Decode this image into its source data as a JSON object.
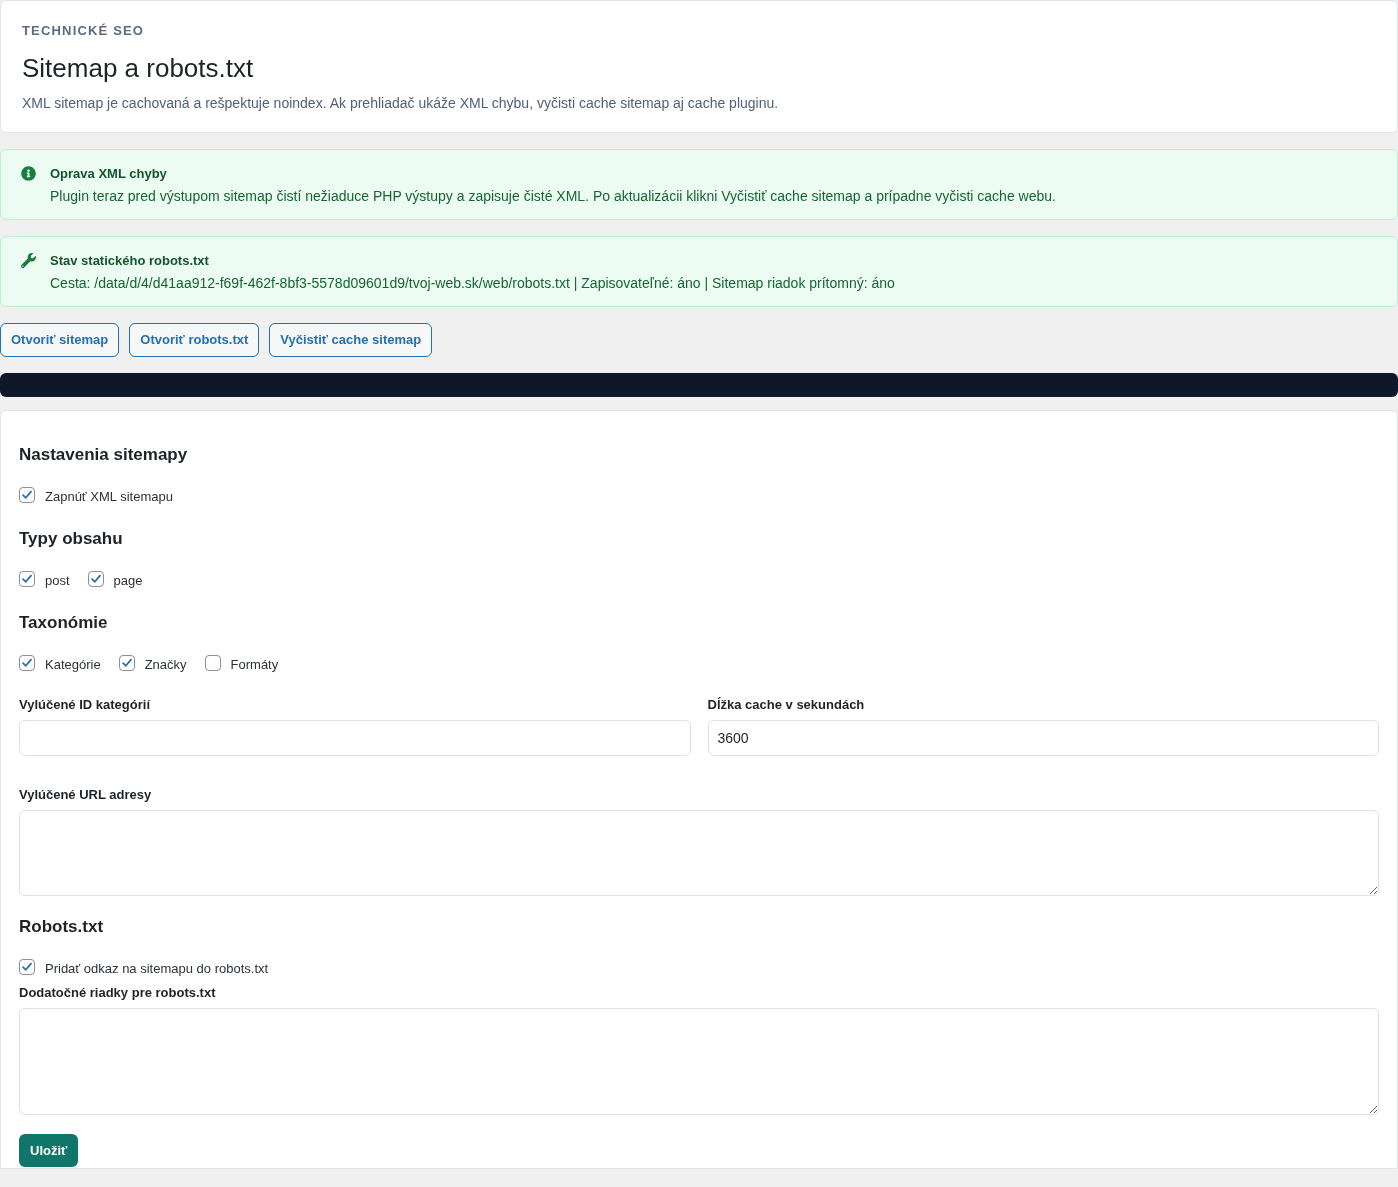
{
  "header": {
    "eyebrow": "TECHNICKÉ SEO",
    "title": "Sitemap a robots.txt",
    "description": "XML sitemap je cachovaná a rešpektuje noindex. Ak prehliadač ukáže XML chybu, vyčisti cache sitemap aj cache pluginu."
  },
  "notices": [
    {
      "kind": "info",
      "title": "Oprava XML chyby",
      "text": "Plugin teraz pred výstupom sitemap čistí nežiaduce PHP výstupy a zapisuje čisté XML. Po aktualizácii klikni Vyčistiť cache sitemap a prípadne vyčisti cache webu."
    },
    {
      "kind": "tool",
      "title": "Stav statického robots.txt",
      "text": "Cesta: /data/d/4/d41aa912-f69f-462f-8bf3-5578d09601d9/tvoj-web.sk/web/robots.txt | Zapisovateľné: áno | Sitemap riadok prítomný: áno"
    }
  ],
  "actions": [
    {
      "label": "Otvoriť sitemap"
    },
    {
      "label": "Otvoriť robots.txt"
    },
    {
      "label": "Vyčistiť cache sitemap"
    }
  ],
  "form": {
    "blocks": [
      {
        "kind": "heading",
        "text": "Nastavenia sitemapy"
      },
      {
        "kind": "checkboxes",
        "items": [
          {
            "label": "Zapnúť XML sitemapu",
            "checked": true
          }
        ]
      },
      {
        "kind": "heading",
        "text": "Typy obsahu"
      },
      {
        "kind": "checkboxes",
        "items": [
          {
            "label": "post",
            "checked": true
          },
          {
            "label": "page",
            "checked": true
          }
        ]
      },
      {
        "kind": "heading",
        "text": "Taxonómie"
      },
      {
        "kind": "checkboxes",
        "items": [
          {
            "label": "Kategórie",
            "checked": true
          },
          {
            "label": "Značky",
            "checked": true
          },
          {
            "label": "Formáty",
            "checked": false
          }
        ]
      },
      {
        "kind": "inputs",
        "fields": [
          {
            "label": "Vylúčené ID kategórií"
          },
          {
            "label": "Dĺžka cache v sekundách",
            "value": "3600"
          }
        ]
      },
      {
        "kind": "textarea",
        "label": "Vylúčené URL adresy"
      },
      {
        "kind": "heading",
        "text": "Robots.txt"
      },
      {
        "kind": "checkboxes",
        "items": [
          {
            "label": "Pridať odkaz na sitemapu do robots.txt",
            "checked": true
          }
        ]
      },
      {
        "kind": "textarea",
        "label": "Dodatočné riadky pre robots.txt"
      }
    ],
    "submit": {
      "label": "Uložiť"
    }
  }
}
